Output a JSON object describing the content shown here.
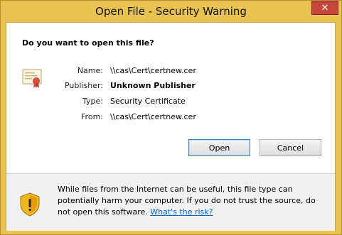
{
  "window": {
    "title": "Open File - Security Warning",
    "close_glyph": "✕",
    "frame_color": "#e8c352"
  },
  "question": "Do you want to open this file?",
  "file_info": {
    "name_label": "Name:",
    "name_value": "\\\\cas\\Cert\\certnew.cer",
    "publisher_label": "Publisher:",
    "publisher_value": "Unknown Publisher",
    "type_label": "Type:",
    "type_value": "Security Certificate",
    "from_label": "From:",
    "from_value": "\\\\cas\\Cert\\certnew.cer",
    "icon": "certificate-icon"
  },
  "buttons": {
    "open_label": "Open",
    "cancel_label": "Cancel"
  },
  "footer": {
    "icon": "warning-shield-icon",
    "warning_text": "While files from the Internet can be useful, this file type can potentially harm your computer. If you do not trust the source, do not open this software.",
    "link_text": "What's the risk?"
  }
}
